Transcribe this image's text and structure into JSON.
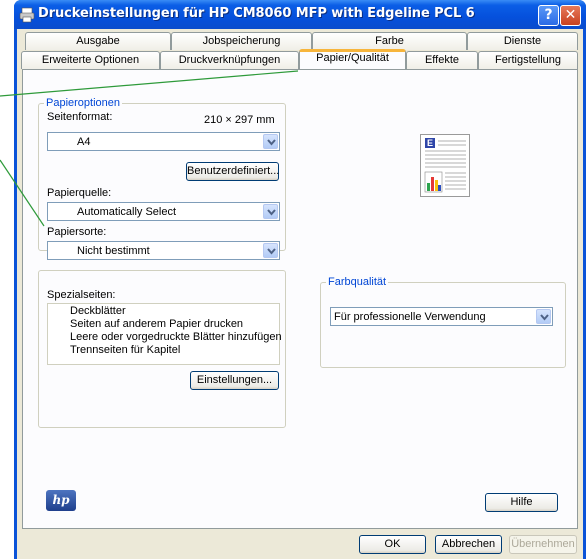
{
  "window": {
    "title": "Druckeinstellungen für HP CM8060 MFP with Edgeline PCL 6",
    "help_glyph": "?",
    "close_glyph": "✕"
  },
  "tabs_row1": [
    "Ausgabe",
    "Jobspeicherung",
    "Farbe",
    "Dienste"
  ],
  "tabs_row2": [
    "Erweiterte Optionen",
    "Druckverknüpfungen",
    "Papier/Qualität",
    "Effekte",
    "Fertigstellung"
  ],
  "selected_tab": "Papier/Qualität",
  "paper_options": {
    "group_label": "Papieroptionen",
    "size_label": "Seitenformat:",
    "size_value": "210 × 297 mm",
    "size_select": "A4",
    "custom_button": "Benutzerdefiniert...",
    "source_label": "Papierquelle:",
    "source_select": "Automatically Select",
    "type_label": "Papiersorte:",
    "type_select": "Nicht bestimmt"
  },
  "special_pages": {
    "label": "Spezialseiten:",
    "items": [
      "Deckblätter",
      "Seiten auf anderem Papier drucken",
      "Leere oder vorgedruckte Blätter hinzufügen",
      "Trennseiten für Kapitel"
    ],
    "settings_button": "Einstellungen..."
  },
  "color_quality": {
    "group_label": "Farbqualität",
    "select": "Für professionelle Verwendung"
  },
  "preview_letter": "E",
  "footer": {
    "logo_text": "hp",
    "help_button": "Hilfe"
  },
  "dialog_buttons": {
    "ok": "OK",
    "cancel": "Abbrechen",
    "apply": "Übernehmen"
  },
  "colors": {
    "titlebar": "#0550dc",
    "selected_tab_accent": "#f7b53c",
    "group_label": "#0046d5",
    "callout_line": "#2e9a3a"
  }
}
